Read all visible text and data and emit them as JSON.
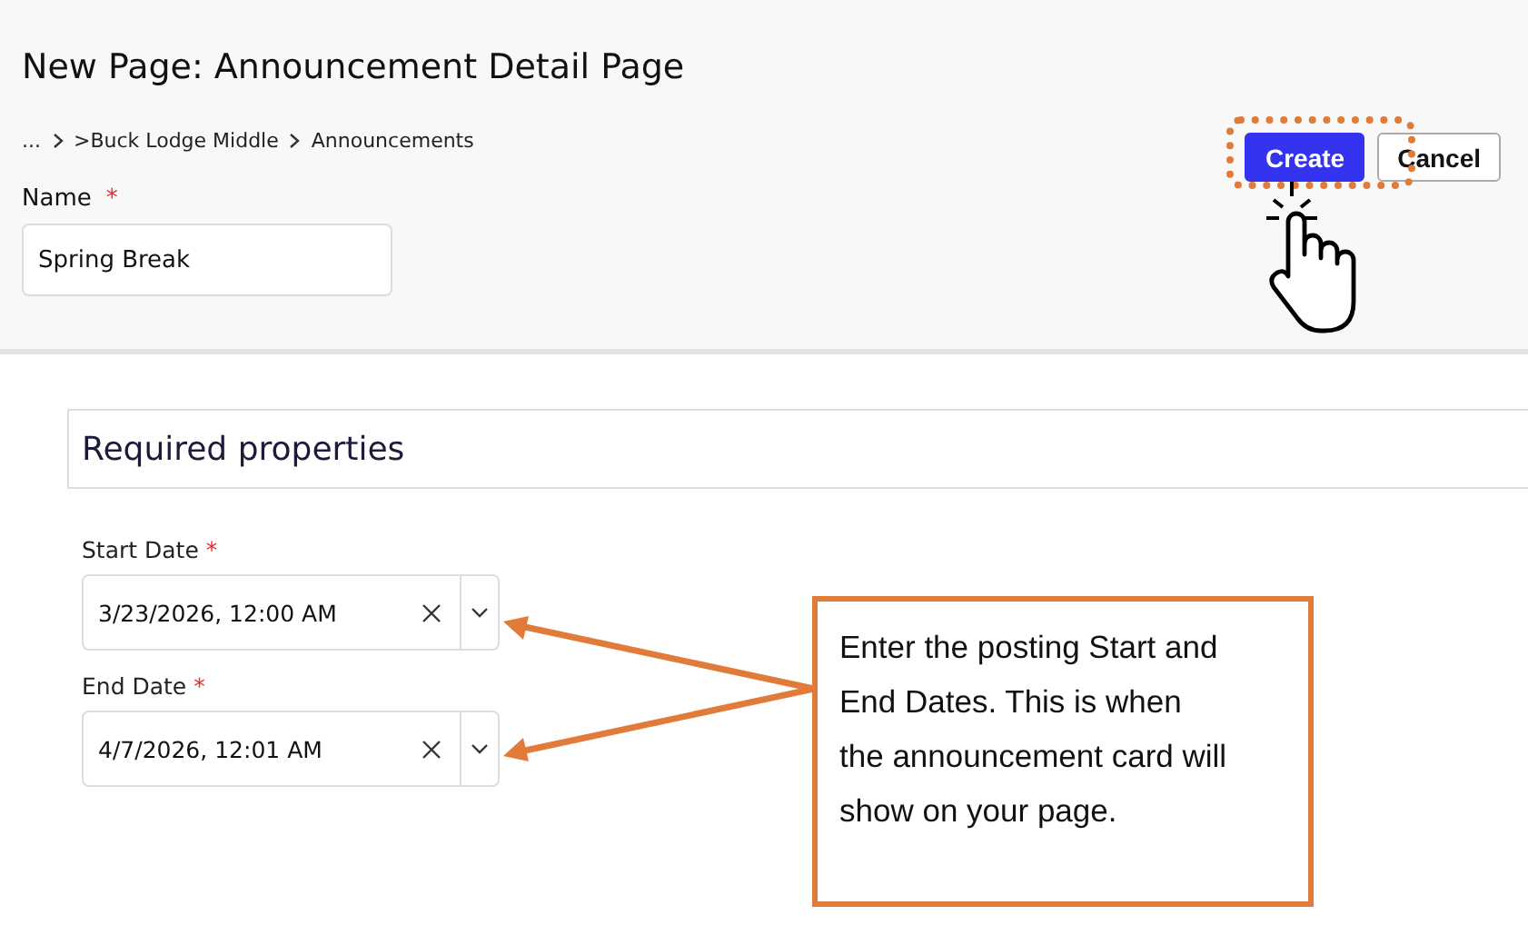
{
  "header": {
    "title": "New Page: Announcement Detail Page",
    "breadcrumb": [
      "...",
      ">Buck Lodge Middle",
      "Announcements"
    ],
    "buttons": [
      {
        "label": "Create",
        "kind": "primary",
        "highlighted": true
      },
      {
        "label": "Cancel",
        "kind": "secondary",
        "highlighted": false
      }
    ],
    "name_field": {
      "label": "Name",
      "required_mark": "*",
      "value": "Spring Break"
    }
  },
  "section": {
    "title": "Required properties"
  },
  "date_fields": [
    {
      "label": "Start Date",
      "required_mark": "*",
      "value": "3/23/2026, 12:00 AM"
    },
    {
      "label": "End Date",
      "required_mark": "*",
      "value": "4/7/2026, 12:01 AM"
    }
  ],
  "callout": {
    "text": "Enter the posting Start and End Dates. This is when the announcement card will show on your page."
  }
}
